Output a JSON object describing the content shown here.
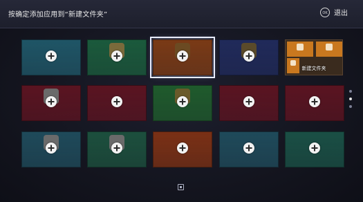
{
  "header": {
    "title": "按确定添加应用到“新建文件夹”",
    "exit_label": "退出",
    "exit_icon_text": "OK"
  },
  "tiles": [
    {
      "name": "",
      "color": "#1f5566"
    },
    {
      "name": "",
      "color": "#1b5a3c",
      "app_color": "#7a6a3b"
    },
    {
      "name": "",
      "color": "#7a3a16",
      "app_color": "#6b4a22",
      "selected": true
    },
    {
      "name": "",
      "color": "#202a5a",
      "app_color": "#5a4a2a"
    },
    {
      "name": "",
      "color": "#5a1421",
      "app_color": "#6a6a6a"
    },
    {
      "name": "",
      "color": "#5a1421"
    },
    {
      "name": "",
      "color": "#1f5a2c",
      "app_color": "#6a5a2a"
    },
    {
      "name": "",
      "color": "#5a1421"
    },
    {
      "name": "",
      "color": "#5a1421"
    },
    {
      "name": "",
      "color": "#1f4a5a",
      "app_color": "#6a6a6a"
    },
    {
      "name": "",
      "color": "#1c4f3d",
      "app_color": "#6a6a6a"
    },
    {
      "name": "",
      "color": "#7a3015"
    },
    {
      "name": "",
      "color": "#1f4a5a"
    },
    {
      "name": "",
      "color": "#1a4f45"
    }
  ],
  "folder": {
    "label": "新建文件夹",
    "slots": [
      {
        "label": "",
        "color": "#c9781f"
      },
      {
        "label": "",
        "color": "#c9781f"
      },
      {
        "label": "",
        "color": "#c9781f"
      }
    ]
  },
  "pager": {
    "active_index": 1
  }
}
